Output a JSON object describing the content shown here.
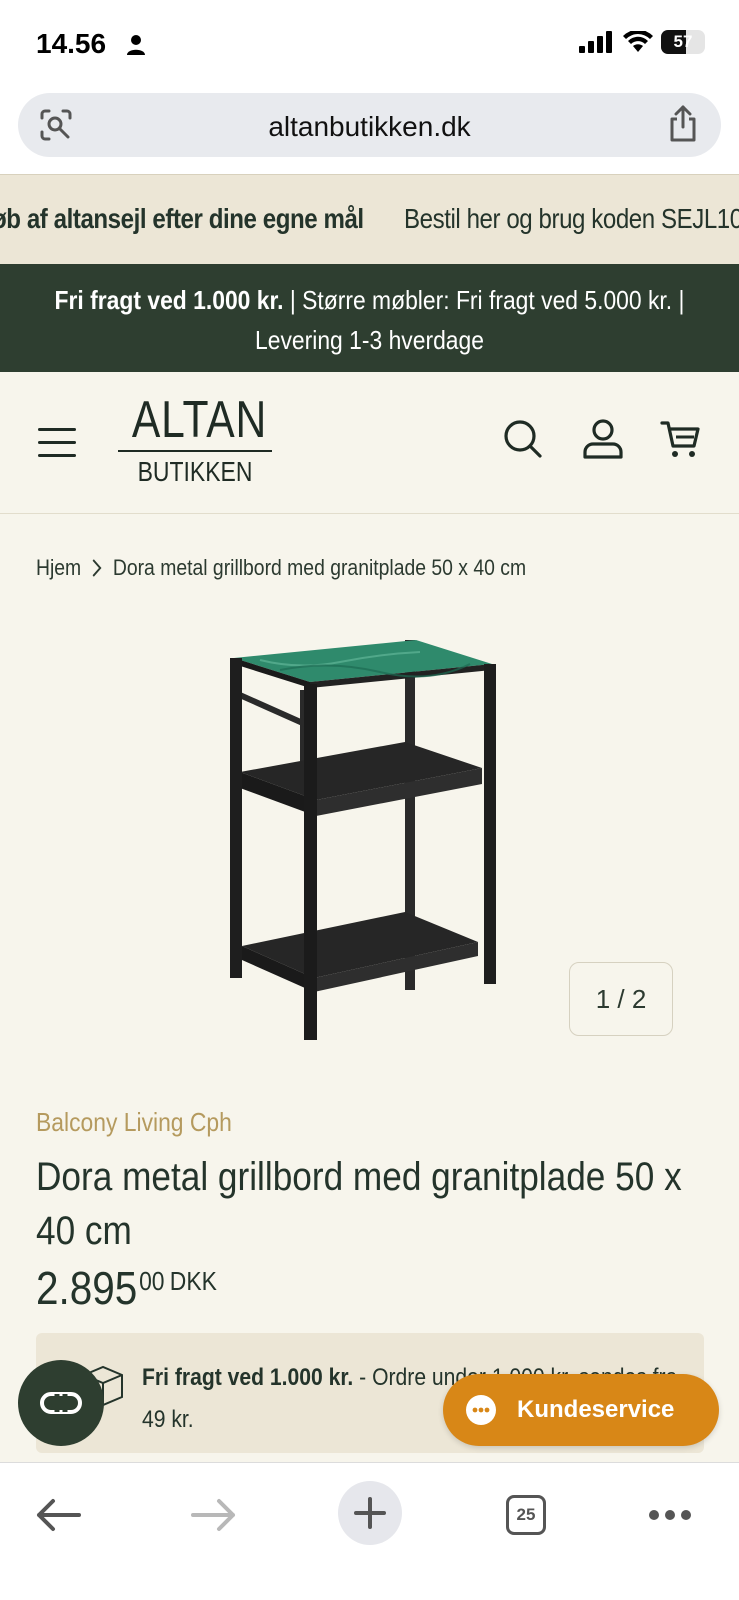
{
  "status_bar": {
    "time": "14.56",
    "battery": "57",
    "battery_level": 0.57
  },
  "browser": {
    "url": "altanbutikken.dk",
    "tabs_count": "25"
  },
  "marquee": {
    "item_a": "øb af altansejl efter dine egne mål",
    "item_b": "Bestil her og brug koden SEJL10"
  },
  "announcement": {
    "part1_bold": "Fri fragt ved 1.000 kr.",
    "part2": " | Større møbler: Fri fragt ved 5.000 kr. |",
    "line2": "Levering 1-3 hverdage"
  },
  "header": {
    "logo_top": "ALTAN",
    "logo_bottom": "BUTIKKEN"
  },
  "breadcrumb": {
    "home": "Hjem",
    "current": "Dora metal grillbord med granitplade 50 x 40 cm"
  },
  "gallery": {
    "counter": "1 / 2"
  },
  "product": {
    "vendor": "Balcony Living Cph",
    "title": "Dora metal grillbord med granitplade 50 x 40 cm",
    "price_main": "2.895",
    "price_decimals": "00",
    "currency": "DKK"
  },
  "shipping": {
    "bold": "Fri fragt ved 1.000 kr.",
    "rest": " - Ordre under 1.000 kr. sendes fra 49 kr."
  },
  "support": {
    "label": "Kundeservice"
  },
  "colors": {
    "dark_green": "#2e3e30",
    "beige": "#ece6d6",
    "gold": "#b59a5e",
    "orange": "#d88717",
    "granite_green": "#2f8a6c"
  }
}
